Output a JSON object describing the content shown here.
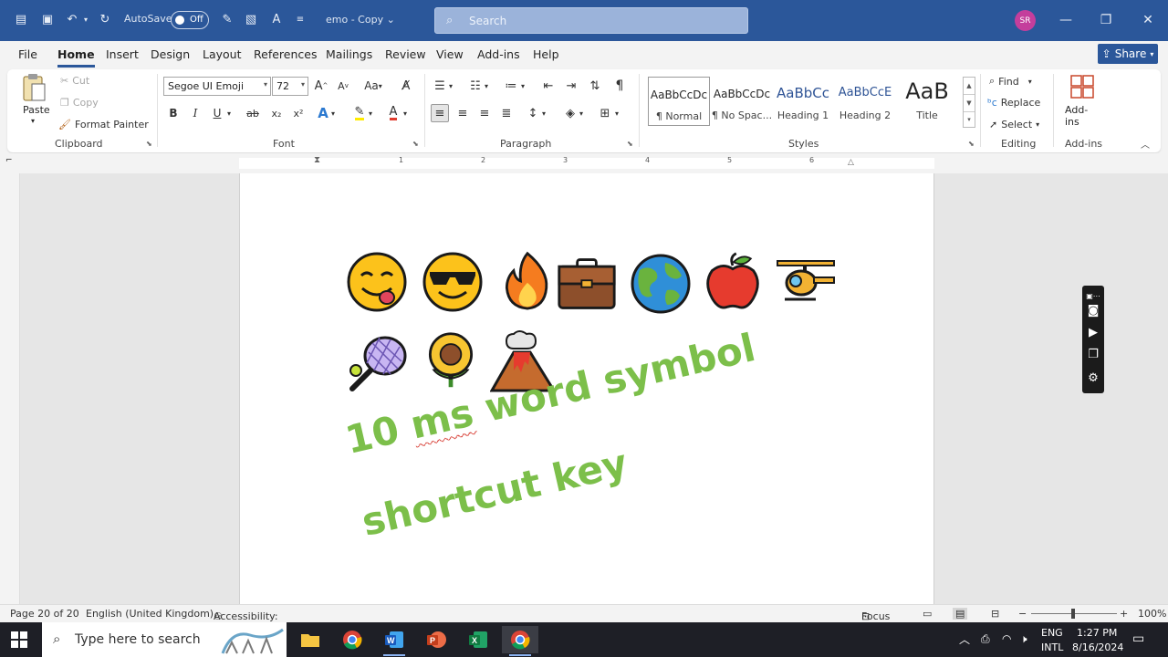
{
  "titlebar": {
    "autosave_label": "AutoSave",
    "autosave_state": "Off",
    "doc_name": "emo - Copy",
    "search_placeholder": "Search",
    "user_initials": "SR"
  },
  "menu": {
    "tabs": [
      "File",
      "Home",
      "Insert",
      "Design",
      "Layout",
      "References",
      "Mailings",
      "Review",
      "View",
      "Add-ins",
      "Help"
    ],
    "active_tab": "Home",
    "share_label": "Share"
  },
  "ribbon": {
    "clipboard": {
      "paste": "Paste",
      "cut": "Cut",
      "copy": "Copy",
      "format_painter": "Format Painter",
      "label": "Clipboard"
    },
    "font": {
      "family": "Segoe UI Emoji",
      "size": "72",
      "label": "Font",
      "bold": "B",
      "italic": "I",
      "underline": "U",
      "strike": "ab",
      "subscript": "x₂",
      "superscript": "x²",
      "change_case": "Aa"
    },
    "paragraph": {
      "label": "Paragraph"
    },
    "styles": {
      "label": "Styles",
      "items": [
        {
          "preview": "AaBbCcDc",
          "name": "¶ Normal"
        },
        {
          "preview": "AaBbCcDc",
          "name": "¶ No Spac..."
        },
        {
          "preview": "AaBbCc",
          "name": "Heading 1"
        },
        {
          "preview": "AaBbCcE",
          "name": "Heading 2"
        },
        {
          "preview": "AaB",
          "name": "Title"
        }
      ]
    },
    "editing": {
      "find": "Find",
      "replace": "Replace",
      "select": "Select",
      "label": "Editing"
    },
    "addins": {
      "button": "Add-ins",
      "label": "Add-ins"
    }
  },
  "ruler": {
    "numbers": [
      "1",
      "2",
      "3",
      "4",
      "5",
      "6"
    ]
  },
  "document": {
    "emojis_row1": [
      "face savoring food",
      "smiling face with sunglasses",
      "fire",
      "briefcase",
      "globe",
      "red apple",
      "helicopter"
    ],
    "emojis_row2": [
      "tennis",
      "sunflower",
      "volcano"
    ],
    "wordart_line1_a": "10 ",
    "wordart_line1_b": "ms",
    "wordart_line1_c": " word symbol",
    "wordart_line2": "shortcut key"
  },
  "statusbar": {
    "page": "Page 20 of 20",
    "language": "English (United Kingdom)",
    "accessibility": "Accessibility: Investigate",
    "focus": "Focus",
    "zoom": "100%"
  },
  "taskbar": {
    "search_placeholder": "Type here to search",
    "lang_top": "ENG",
    "lang_bottom": "INTL",
    "time": "1:27 PM",
    "date": "8/16/2024"
  },
  "colors": {
    "accent": "#2b579a",
    "wordart": "#7cbf4a",
    "avatar": "#c43e9c"
  }
}
